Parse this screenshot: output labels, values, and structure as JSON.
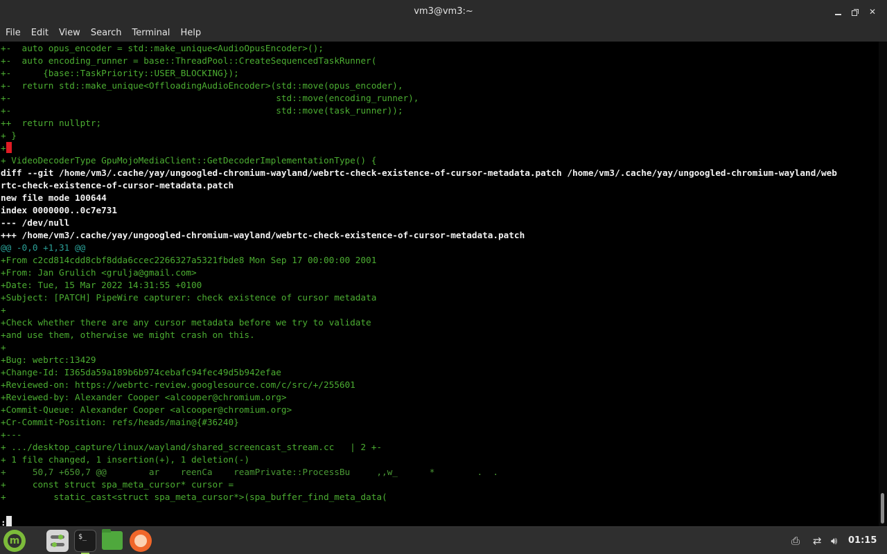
{
  "window": {
    "title": "vm3@vm3:~",
    "controls": {
      "minimize": "minimize-icon",
      "maximize": "maximize-icon",
      "close": "close-icon"
    }
  },
  "menu": [
    "File",
    "Edit",
    "View",
    "Search",
    "Terminal",
    "Help"
  ],
  "terminal": {
    "lines": [
      {
        "text": "+-  auto opus_encoder = std::make_unique<AudioOpusEncoder>();",
        "style": "green"
      },
      {
        "text": "+-  auto encoding_runner = base::ThreadPool::CreateSequencedTaskRunner(",
        "style": "green"
      },
      {
        "text": "+-      {base::TaskPriority::USER_BLOCKING});",
        "style": "green"
      },
      {
        "text": "+-  return std::make_unique<OffloadingAudioEncoder>(std::move(opus_encoder),",
        "style": "green"
      },
      {
        "text": "+-                                                  std::move(encoding_runner),",
        "style": "green"
      },
      {
        "text": "+-                                                  std::move(task_runner));",
        "style": "green"
      },
      {
        "text": "++  return nullptr;",
        "style": "green"
      },
      {
        "text": "+ }",
        "style": "green"
      },
      {
        "text": "+",
        "style": "green",
        "cursor": "red"
      },
      {
        "text": "+ VideoDecoderType GpuMojoMediaClient::GetDecoderImplementationType() {",
        "style": "green"
      },
      {
        "text": "diff --git /home/vm3/.cache/yay/ungoogled-chromium-wayland/webrtc-check-existence-of-cursor-metadata.patch /home/vm3/.cache/yay/ungoogled-chromium-wayland/web",
        "style": "white"
      },
      {
        "text": "rtc-check-existence-of-cursor-metadata.patch",
        "style": "white"
      },
      {
        "text": "new file mode 100644",
        "style": "white"
      },
      {
        "text": "index 0000000..0c7e731",
        "style": "white"
      },
      {
        "text": "--- /dev/null",
        "style": "white"
      },
      {
        "text": "+++ /home/vm3/.cache/yay/ungoogled-chromium-wayland/webrtc-check-existence-of-cursor-metadata.patch",
        "style": "white"
      },
      {
        "text": "@@ -0,0 +1,31 @@",
        "style": "cyan"
      },
      {
        "text": "+From c2cd814cdd8cbf8dda6ccec2266327a5321fbde8 Mon Sep 17 00:00:00 2001",
        "style": "green"
      },
      {
        "text": "+From: Jan Grulich <grulja@gmail.com>",
        "style": "green"
      },
      {
        "text": "+Date: Tue, 15 Mar 2022 14:31:55 +0100",
        "style": "green"
      },
      {
        "text": "+Subject: [PATCH] PipeWire capturer: check existence of cursor metadata",
        "style": "green"
      },
      {
        "text": "+",
        "style": "green"
      },
      {
        "text": "+Check whether there are any cursor metadata before we try to validate",
        "style": "green"
      },
      {
        "text": "+and use them, otherwise we might crash on this.",
        "style": "green"
      },
      {
        "text": "+",
        "style": "green"
      },
      {
        "text": "+Bug: webrtc:13429",
        "style": "green"
      },
      {
        "text": "+Change-Id: I365da59a189b6b974cebafc94fec49d5b942efae",
        "style": "green"
      },
      {
        "text": "+Reviewed-on: https://webrtc-review.googlesource.com/c/src/+/255601",
        "style": "green"
      },
      {
        "text": "+Reviewed-by: Alexander Cooper <alcooper@chromium.org>",
        "style": "green"
      },
      {
        "text": "+Commit-Queue: Alexander Cooper <alcooper@chromium.org>",
        "style": "green"
      },
      {
        "text": "+Cr-Commit-Position: refs/heads/main@{#36240}",
        "style": "green"
      },
      {
        "text": "+---",
        "style": "green"
      },
      {
        "text": "+ .../desktop_capture/linux/wayland/shared_screencast_stream.cc   | 2 +-",
        "style": "green"
      },
      {
        "text": "+ 1 file changed, 1 insertion(+), 1 deletion(-)",
        "style": "green"
      },
      {
        "text": "+     50,7 +650,7 @@        ar    reenCa    reamPrivate::ProcessBu     ,,w_      *        .  .",
        "style": "dim"
      },
      {
        "text": "+     const struct spa_meta_cursor* cursor =",
        "style": "green"
      },
      {
        "text": "+         static_cast<struct spa_meta_cursor*>(spa_buffer_find_meta_data(",
        "style": "green"
      },
      {
        "text": "",
        "style": "green"
      },
      {
        "text": ":",
        "style": "white-plain",
        "cursor": "white"
      }
    ]
  },
  "taskbar": {
    "apps": [
      "mint-menu-icon",
      "system-settings-icon",
      "terminal-icon",
      "files-icon",
      "firefox-icon"
    ],
    "tray": [
      "printer-icon",
      "network-icon",
      "volume-icon"
    ],
    "clock": "01:15"
  }
}
